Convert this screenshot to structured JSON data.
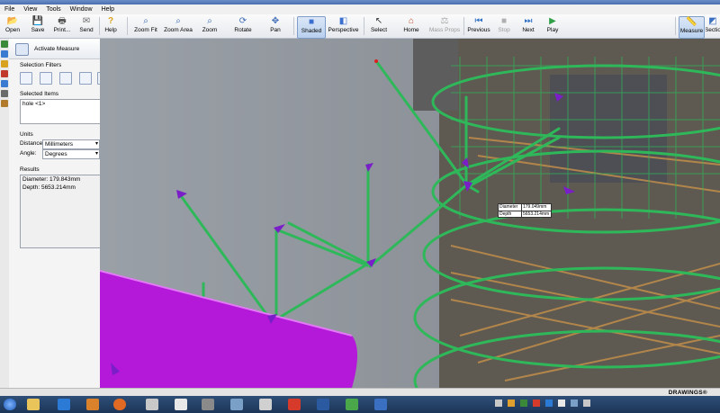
{
  "menu": [
    "File",
    "View",
    "Tools",
    "Window",
    "Help"
  ],
  "toolbar": [
    {
      "label": "Open",
      "icon": "open-folder-icon",
      "glyph": "📂",
      "state": "normal"
    },
    {
      "label": "Save",
      "icon": "save-icon",
      "glyph": "💾",
      "state": "normal"
    },
    {
      "label": "Print...",
      "icon": "print-icon",
      "glyph": "🖶",
      "state": "normal"
    },
    {
      "label": "Send",
      "icon": "send-icon",
      "glyph": "✉",
      "state": "normal"
    },
    {
      "label": "Help",
      "icon": "help-icon",
      "glyph": "?",
      "state": "normal"
    },
    {
      "label": "Zoom Fit",
      "icon": "zoom-fit-icon",
      "glyph": "⌕",
      "state": "normal"
    },
    {
      "label": "Zoom Area",
      "icon": "zoom-area-icon",
      "glyph": "⌕",
      "state": "normal"
    },
    {
      "label": "Zoom",
      "icon": "zoom-icon",
      "glyph": "⌕",
      "state": "normal"
    },
    {
      "label": "Rotate",
      "icon": "rotate-icon",
      "glyph": "⟳",
      "state": "normal"
    },
    {
      "label": "Pan",
      "icon": "pan-icon",
      "glyph": "✥",
      "state": "normal"
    },
    {
      "label": "Shaded",
      "icon": "shaded-cube-icon",
      "glyph": "■",
      "state": "active"
    },
    {
      "label": "Perspective",
      "icon": "perspective-cube-icon",
      "glyph": "◧",
      "state": "normal"
    },
    {
      "label": "Select",
      "icon": "select-arrow-icon",
      "glyph": "↖",
      "state": "normal"
    },
    {
      "label": "Home",
      "icon": "home-icon",
      "glyph": "⌂",
      "state": "normal"
    },
    {
      "label": "Mass Props",
      "icon": "mass-props-icon",
      "glyph": "⚖",
      "state": "disabled"
    },
    {
      "label": "Previous",
      "icon": "previous-icon",
      "glyph": "⏮",
      "state": "normal"
    },
    {
      "label": "Stop",
      "icon": "stop-icon",
      "glyph": "■",
      "state": "disabled"
    },
    {
      "label": "Next",
      "icon": "next-icon",
      "glyph": "⏭",
      "state": "normal"
    },
    {
      "label": "Play",
      "icon": "play-icon",
      "glyph": "▶",
      "state": "normal"
    },
    {
      "label": "Measure",
      "icon": "measure-icon",
      "glyph": "📏",
      "state": "active"
    },
    {
      "label": "Sectio",
      "icon": "section-icon",
      "glyph": "◩",
      "state": "normal"
    }
  ],
  "panel": {
    "activate_measure": "Activate Measure",
    "selection_filters_title": "Selection Filters",
    "selected_items_title": "Selected Items",
    "selected_items": [
      "hole <1>"
    ],
    "units_title": "Units",
    "distance_label": "Distance:",
    "distance_value": "Millimeters",
    "angle_label": "Angle:",
    "angle_value": "Degrees",
    "results_title": "Results",
    "results": [
      "Diameter: 179.843mm",
      "Depth: 5653.214mm"
    ]
  },
  "measure_tooltip": {
    "diameter_label": "Diameter",
    "diameter_value": "179.049mm",
    "depth_label": "Depth",
    "depth_value": "5653.214mm"
  },
  "statusbar": {
    "brand": "DRAWINGS®"
  },
  "colors": {
    "rebar_green": "#2fb85a",
    "pipe_magenta": "#b418d8",
    "marker_purple": "#7a1ec8",
    "viewport_bg": "#8f9298"
  }
}
